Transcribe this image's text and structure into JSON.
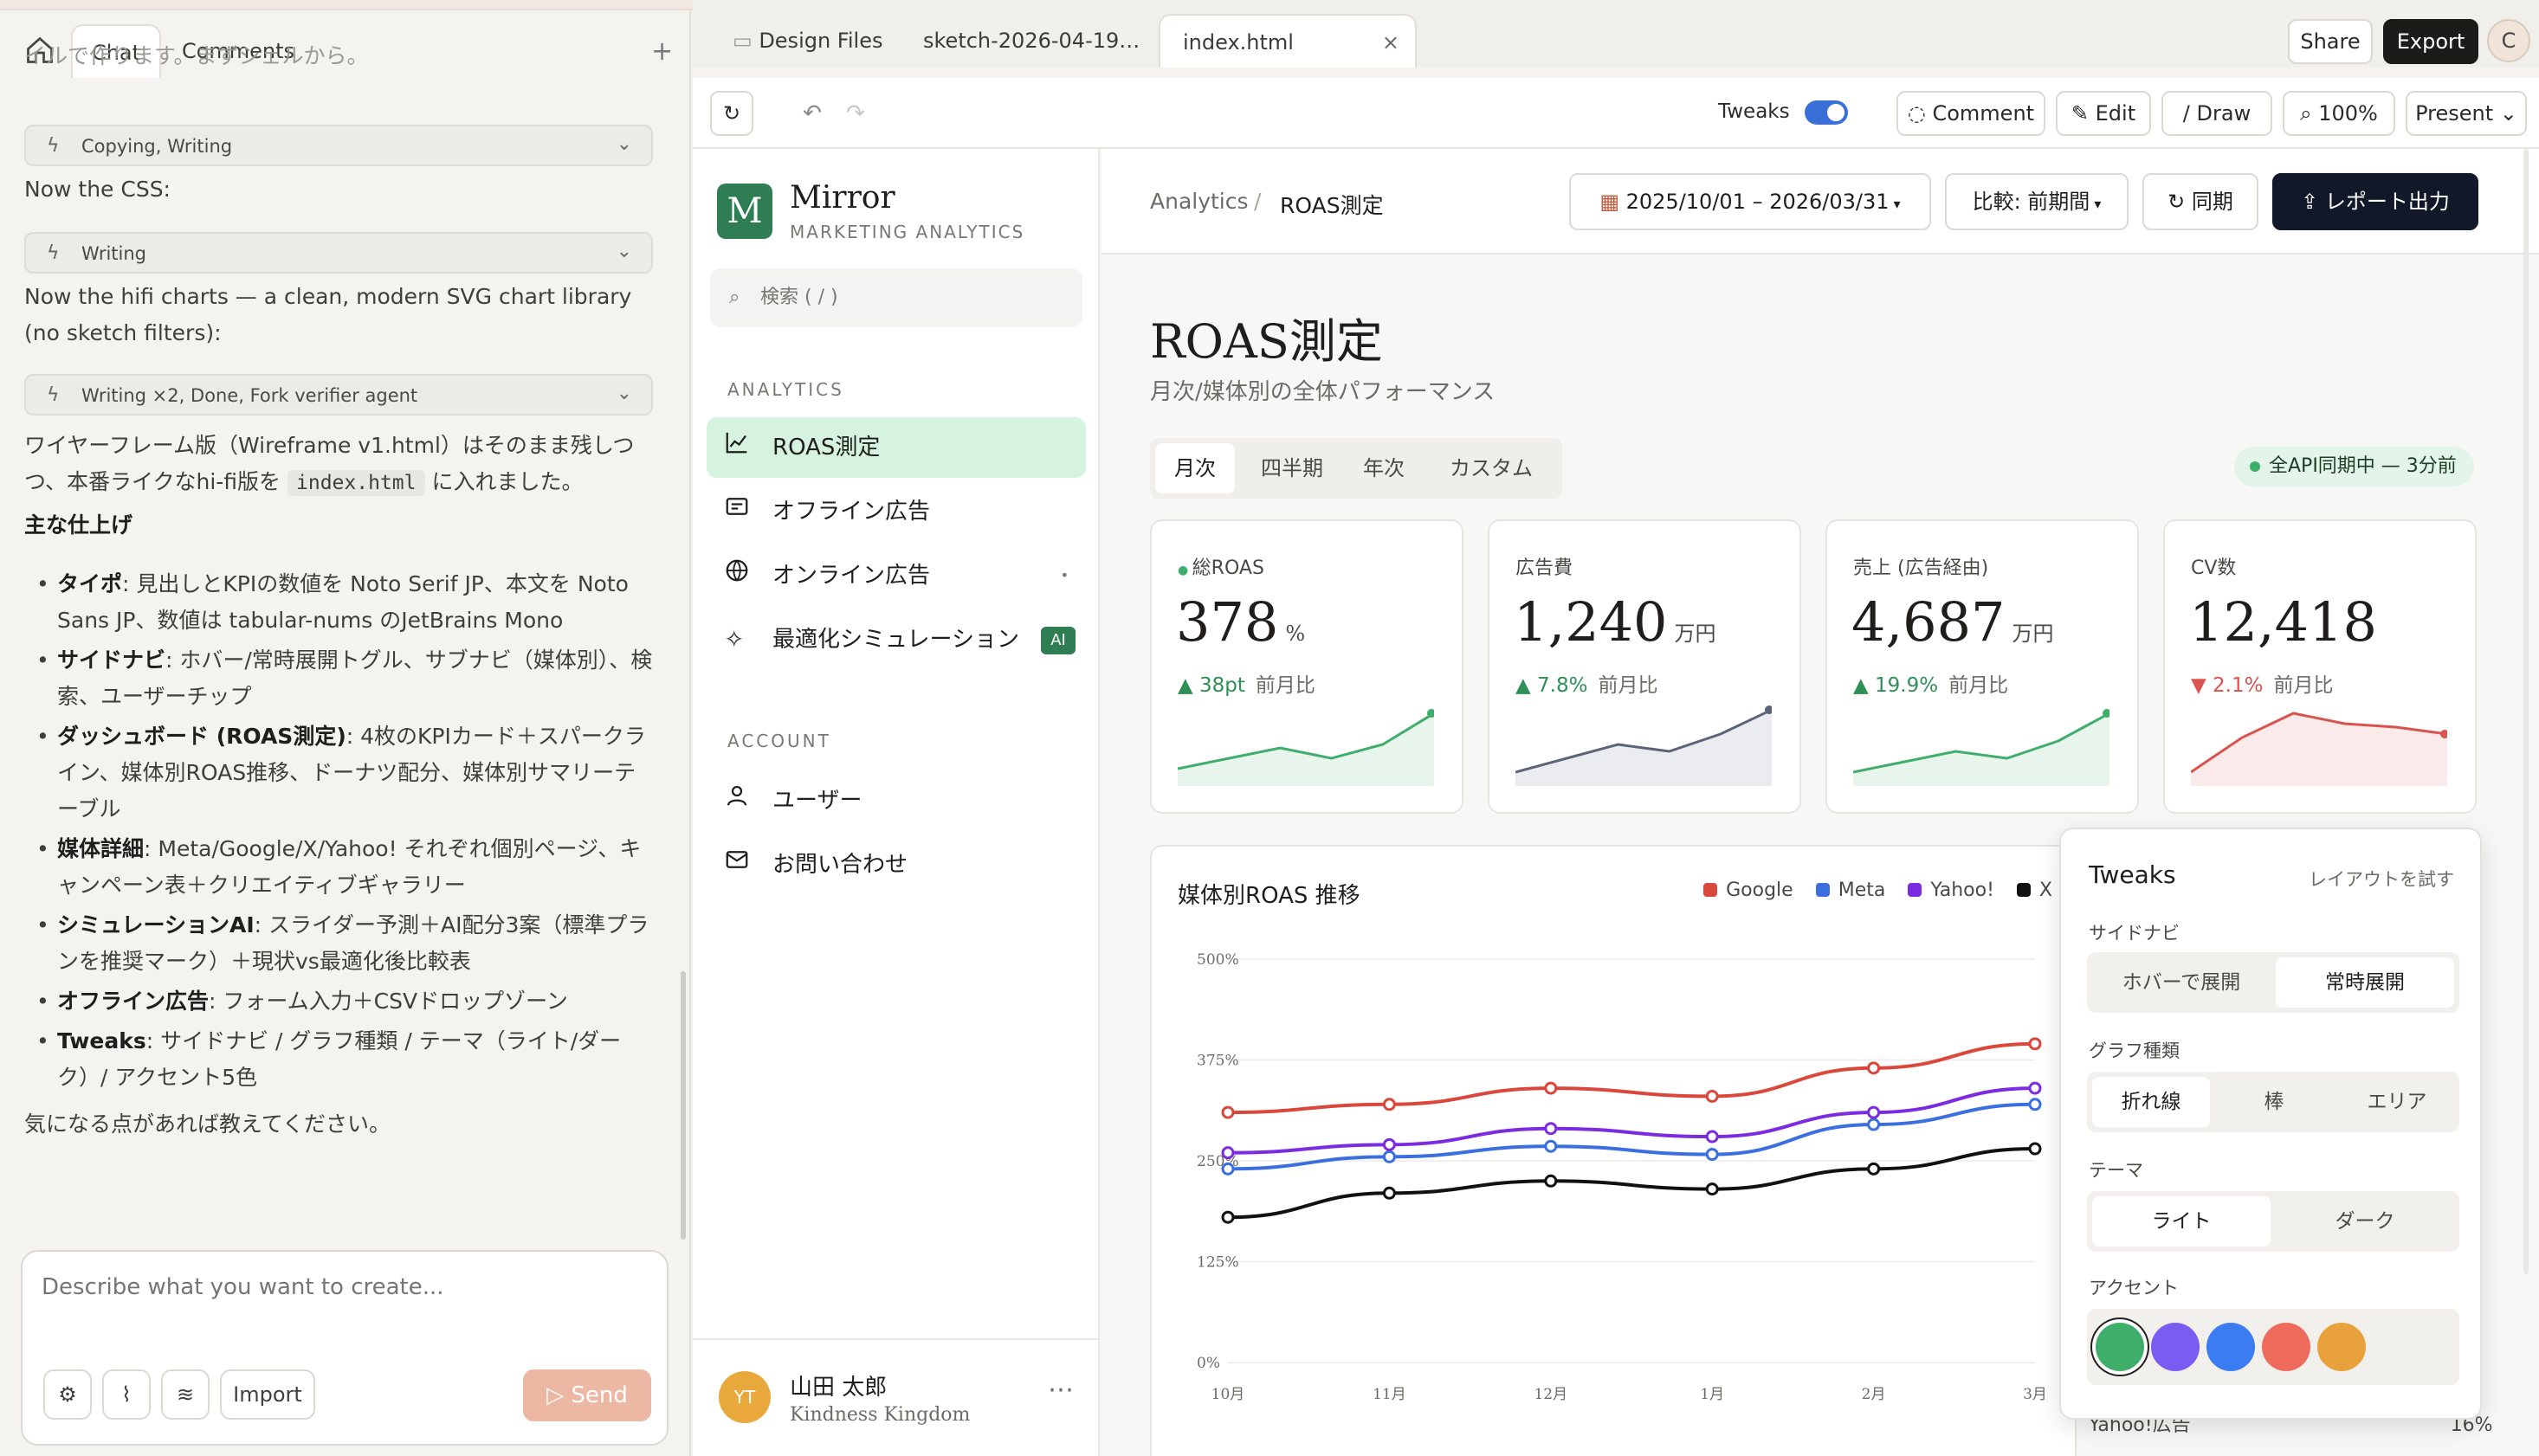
{
  "left_panel": {
    "tabs": [
      "Chat",
      "Comments"
    ],
    "plus": "+",
    "partial_line": "イルで作ります。まずシェルから。",
    "messages": {
      "pill1": "Copying, Writing",
      "css_note": "Now the CSS:",
      "pill2": "Writing",
      "hifi_note": "Now the hifi charts — a clean, modern SVG chart library (no sketch filters):",
      "pill3": "Writing ×2, Done, Fork verifier agent",
      "summary_a": "ワイヤーフレーム版（Wireframe v1.html）はそのまま残しつ",
      "summary_b1": "つ、本番ライクなhi-fi版を",
      "summary_code": "index.html",
      "summary_b2": "に入れました。",
      "heading": "主な仕上げ",
      "bullets": [
        {
          "title": "タイポ",
          "text": ": 見出しとKPIの数値を Noto Serif JP、本文を Noto Sans JP、数値は tabular-nums のJetBrains Mono"
        },
        {
          "title": "サイドナビ",
          "text": ": ホバー/常時展開トグル、サブナビ（媒体別）、検索、ユーザーチップ"
        },
        {
          "title": "ダッシュボード (ROAS測定)",
          "text": ": 4枚のKPIカード＋スパークライン、媒体別ROAS推移、ドーナツ配分、媒体別サマリーテーブル"
        },
        {
          "title": "媒体詳細",
          "text": ": Meta/Google/X/Yahoo! それぞれ個別ページ、キャンペーン表＋クリエイティブギャラリー"
        },
        {
          "title": "シミュレーションAI",
          "text": ": スライダー予測＋AI配分3案（標準プランを推奨マーク）＋現状vs最適化後比較表"
        },
        {
          "title": "オフライン広告",
          "text": ": フォーム入力＋CSVドロップゾーン"
        },
        {
          "title": "Tweaks",
          "text": ": サイドナビ / グラフ種類 / テーマ（ライト/ダーク）/ アクセント5色"
        }
      ],
      "closing": "気になる点があれば教えてください。"
    },
    "composer": {
      "placeholder": "Describe what you want to create...",
      "import": "Import",
      "send": "Send"
    }
  },
  "browser": {
    "tabs": [
      "Design Files",
      "sketch-2026-04-19…",
      "index.html"
    ],
    "close": "×",
    "share": "Share",
    "export": "Export",
    "avatar": "C",
    "toolbar": {
      "tweaks": "Tweaks",
      "comment": "Comment",
      "edit": "Edit",
      "draw": "Draw",
      "zoom": "100%",
      "present": "Present"
    }
  },
  "sidebar": {
    "logo_letter": "M",
    "brand": "Mirror",
    "brand_sub": "MARKETING ANALYTICS",
    "search": "検索 ( / )",
    "sec_analytics": "ANALYTICS",
    "nav": [
      "ROAS測定",
      "オフライン広告",
      "オンライン広告",
      "最適化シミュレーション"
    ],
    "nav_badge": "AI",
    "sec_account": "ACCOUNT",
    "account": [
      "ユーザー",
      "お問い合わせ"
    ],
    "user": {
      "initials": "YT",
      "name": "山田 太郎",
      "org": "Kindness Kingdom"
    }
  },
  "header": {
    "crumb1": "Analytics",
    "crumb_sep": "/",
    "crumb2": "ROAS測定",
    "date_range": "2025/10/01 – 2026/03/31",
    "compare": "比較: 前期間",
    "sync": "同期",
    "report": "レポート出力"
  },
  "page": {
    "title": "ROAS測定",
    "subtitle": "月次/媒体別の全体パフォーマンス",
    "periods": [
      "月次",
      "四半期",
      "年次",
      "カスタム"
    ],
    "sync_status": "全API同期中 — 3分前"
  },
  "kpis": [
    {
      "label": "総ROAS",
      "value": "378",
      "unit": "%",
      "delta": "▲ 38pt",
      "ref": "前月比",
      "color": "#3fae6b",
      "spark": [
        0.15,
        0.3,
        0.45,
        0.3,
        0.5,
        0.95
      ]
    },
    {
      "label": "広告費",
      "value": "1,240",
      "unit": "万円",
      "delta": "▲ 7.8%",
      "ref": "前月比",
      "color": "#5b6478",
      "spark": [
        0.1,
        0.3,
        0.5,
        0.4,
        0.65,
        1.0
      ]
    },
    {
      "label": "売上 (広告経由)",
      "value": "4,687",
      "unit": "万円",
      "delta": "▲ 19.9%",
      "ref": "前月比",
      "color": "#3fae6b",
      "spark": [
        0.1,
        0.25,
        0.4,
        0.3,
        0.55,
        0.95
      ]
    },
    {
      "label": "CV数",
      "value": "12,418",
      "unit": "",
      "delta": "▼ 2.1%",
      "ref": "前月比",
      "color": "#d9534f",
      "spark": [
        0.1,
        0.6,
        0.95,
        0.8,
        0.75,
        0.65
      ]
    }
  ],
  "chart_data": {
    "type": "line",
    "title": "媒体別ROAS 推移",
    "categories": [
      "10月",
      "11月",
      "12月",
      "1月",
      "2月",
      "3月"
    ],
    "y_ticks": [
      "0%",
      "125%",
      "250%",
      "375%",
      "500%"
    ],
    "ylim": [
      0,
      500
    ],
    "legend_position": "top-right",
    "series": [
      {
        "name": "Google",
        "color": "#d9483b",
        "values": [
          310,
          320,
          340,
          330,
          365,
          395
        ]
      },
      {
        "name": "Meta",
        "color": "#3b6fe0",
        "values": [
          240,
          255,
          268,
          258,
          295,
          320
        ]
      },
      {
        "name": "Yahoo!",
        "color": "#7b2be0",
        "values": [
          260,
          270,
          290,
          280,
          310,
          340
        ]
      },
      {
        "name": "X",
        "color": "#111111",
        "values": [
          180,
          210,
          225,
          215,
          240,
          265
        ]
      }
    ]
  },
  "tweaks": {
    "title": "Tweaks",
    "hint": "レイアウトを試す",
    "sidenav_label": "サイドナビ",
    "sidenav_opts": [
      "ホバーで展開",
      "常時展開"
    ],
    "graph_label": "グラフ種類",
    "graph_opts": [
      "折れ線",
      "棒",
      "エリア"
    ],
    "theme_label": "テーマ",
    "theme_opts": [
      "ライト",
      "ダーク"
    ],
    "accent_label": "アクセント",
    "accents": [
      "#3fae6b",
      "#7b5cf0",
      "#3b7cf0",
      "#ee6b5c",
      "#e9a23b"
    ]
  },
  "behind": {
    "row_label": "Yahoo!広告",
    "row_value": "16%"
  }
}
